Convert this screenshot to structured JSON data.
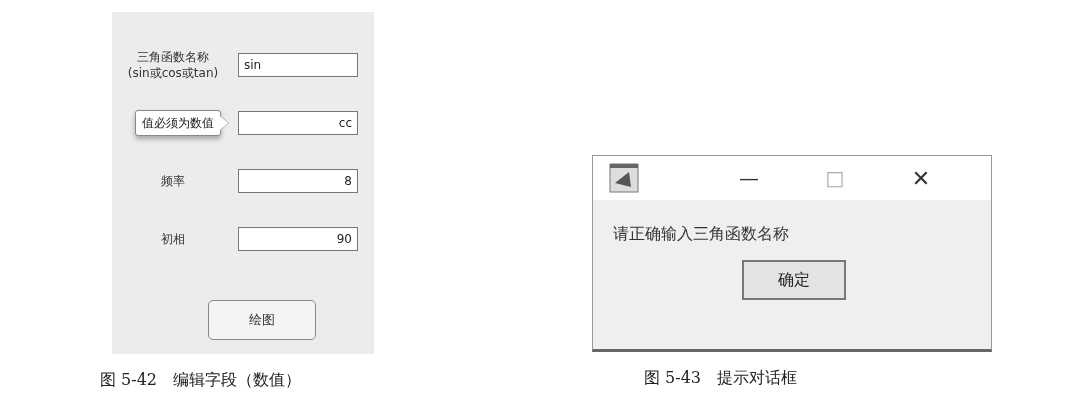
{
  "figure_left": {
    "form": {
      "fields": [
        {
          "kind": "text",
          "label_lines": [
            "三角函数名称",
            "(sin或cos或tan)"
          ],
          "value": "sin"
        },
        {
          "kind": "numeric",
          "tooltip": "值必须为数值",
          "value": "cc"
        },
        {
          "kind": "numeric",
          "label_lines": [
            "频率"
          ],
          "value": "8"
        },
        {
          "kind": "numeric",
          "label_lines": [
            "初相"
          ],
          "value": "90"
        }
      ],
      "button": "绘图"
    },
    "caption": "图 5-42　编辑字段（数值）"
  },
  "figure_right": {
    "dialog": {
      "title_buttons": [
        "—",
        "□",
        "✕"
      ],
      "message": "请正确输入三角函数名称",
      "button": "确定"
    },
    "caption": "图 5-43　提示对话框"
  }
}
